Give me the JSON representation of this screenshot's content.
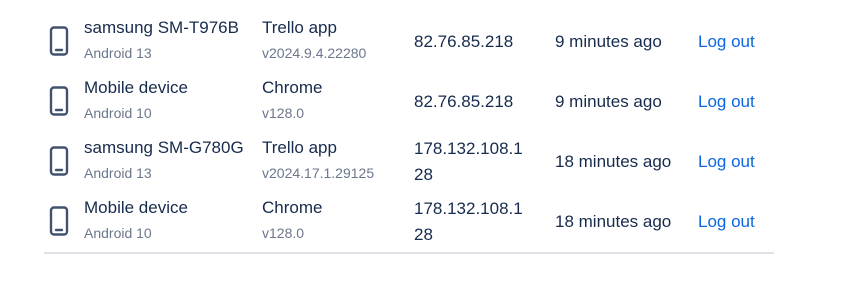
{
  "sessions": [
    {
      "device_name": "samsung SM-T976B",
      "os": "Android 13",
      "app": "Trello app",
      "app_version": "v2024.9.4.22280",
      "ip": "82.76.85.218",
      "last_active": "9 minutes ago",
      "action_label": "Log out",
      "icon": "mobile-phone-icon"
    },
    {
      "device_name": "Mobile device",
      "os": "Android 10",
      "app": "Chrome",
      "app_version": "v128.0",
      "ip": "82.76.85.218",
      "last_active": "9 minutes ago",
      "action_label": "Log out",
      "icon": "mobile-phone-icon"
    },
    {
      "device_name": "samsung SM-G780G",
      "os": "Android 13",
      "app": "Trello app",
      "app_version": "v2024.17.1.29125",
      "ip": "178.132.108.128",
      "last_active": "18 minutes ago",
      "action_label": "Log out",
      "icon": "mobile-phone-icon"
    },
    {
      "device_name": "Mobile device",
      "os": "Android 10",
      "app": "Chrome",
      "app_version": "v128.0",
      "ip": "178.132.108.128",
      "last_active": "18 minutes ago",
      "action_label": "Log out",
      "icon": "mobile-phone-icon"
    }
  ],
  "colors": {
    "primary_text": "#172b4d",
    "secondary_text": "#6b778c",
    "link": "#0c66e4",
    "divider": "#dfe1e6"
  }
}
